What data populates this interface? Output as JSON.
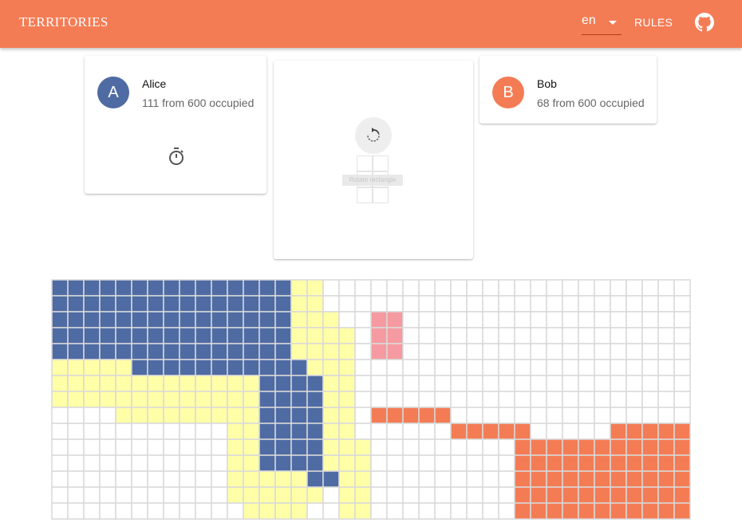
{
  "header": {
    "title": "TERRITORIES",
    "language": "en",
    "rules_label": "RULES"
  },
  "players": [
    {
      "initial": "A",
      "name": "Alice",
      "score": "111 from 600 occupied",
      "color": "#4f6ba3"
    },
    {
      "initial": "B",
      "name": "Bob",
      "score": "68 from 600 occupied",
      "color": "#f47c55"
    }
  ],
  "controls": {
    "rotate_tooltip": "Rotate rectangle",
    "piece": {
      "cols": 2,
      "rows": 3
    }
  },
  "board": {
    "cols": 40,
    "rows": 15,
    "colors": {
      "A": "#4f6ba3",
      "B": "#f47c55",
      "Y": "#ffffa8",
      "P": "#f59aa0",
      "empty": "#ffffff",
      "grid": "#d9d9d9"
    },
    "rows_data": [
      "AAAAAAAAAAAAAAAYY.......................",
      "AAAAAAAAAAAAAAAYY.......................",
      "AAAAAAAAAAAAAAAYYY..PP..................",
      "AAAAAAAAAAAAAAAYYYY.PP..................",
      "AAAAAAAAAAAAAAAYYYY.PP..................",
      "YYYYYAAAAAAAAAAAYYY.....................",
      "YYYYYYYYYYYYYAAAAYY.....................",
      "YYYYYYYYYYYYYAAAAYY.....................",
      "....YYYYYYYYYAAAAYY.BBBBB...............",
      "...........YYAAAAYY......BBBBB.....BBBBB",
      "...........YYAAAAYYY.........BBBBBBBBBBB",
      "...........YYAAAAYYY.........BBBBBBBBBBB",
      "...........YYYYYAAYY.........BBBBBBBBBBB",
      "...........YYYYYY.YY.........BBBBBBBBBBB",
      "............YYYY..YY.........BBBBBBBBBBB"
    ]
  }
}
